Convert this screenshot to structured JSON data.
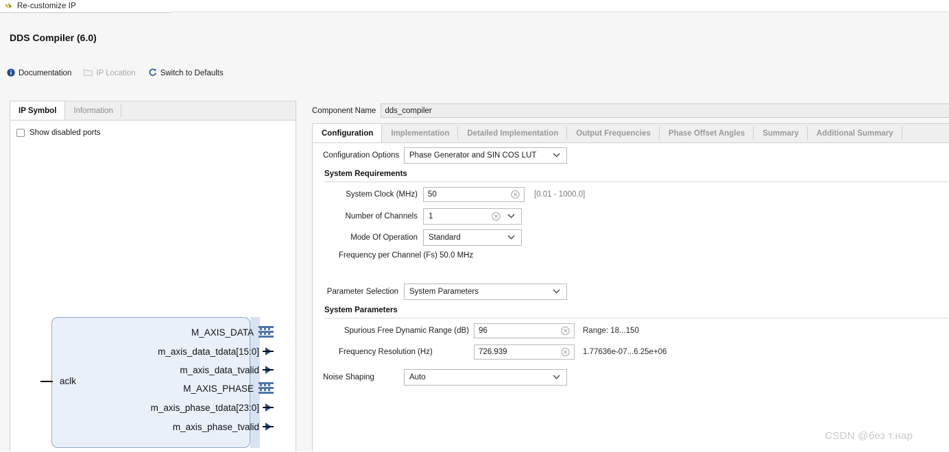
{
  "window": {
    "title": "Re-customize IP",
    "app_icon": "xilinx-logo-icon",
    "product_title": "DDS Compiler (6.0)"
  },
  "toolbar": {
    "items": [
      {
        "label": "Documentation",
        "icon": "info-icon",
        "disabled": false
      },
      {
        "label": "IP Location",
        "icon": "folder-icon",
        "disabled": true
      },
      {
        "label": "Switch to Defaults",
        "icon": "refresh-icon",
        "disabled": false
      }
    ]
  },
  "left_panel": {
    "tabs": [
      {
        "label": "IP Symbol",
        "active": true
      },
      {
        "label": "Information",
        "active": false
      }
    ],
    "show_disabled_ports": {
      "label": "Show disabled ports",
      "checked": false
    },
    "symbol": {
      "clock_port": "aclk",
      "ports": [
        {
          "name": "M_AXIS_DATA",
          "marker": "bus"
        },
        {
          "name": "m_axis_data_tdata[15:0]",
          "marker": "signal"
        },
        {
          "name": "m_axis_data_tvalid",
          "marker": "signal"
        },
        {
          "name": "M_AXIS_PHASE",
          "marker": "bus"
        },
        {
          "name": "m_axis_phase_tdata[23:0]",
          "marker": "signal"
        },
        {
          "name": "m_axis_phase_tvalid",
          "marker": "signal"
        }
      ]
    }
  },
  "right_panel": {
    "component_name": {
      "label": "Component Name",
      "value": "dds_compiler"
    },
    "tabs": [
      {
        "label": "Configuration",
        "active": true
      },
      {
        "label": "Implementation",
        "active": false
      },
      {
        "label": "Detailed Implementation",
        "active": false
      },
      {
        "label": "Output Frequencies",
        "active": false
      },
      {
        "label": "Phase Offset Angles",
        "active": false
      },
      {
        "label": "Summary",
        "active": false
      },
      {
        "label": "Additional Summary",
        "active": false
      }
    ],
    "configuration": {
      "configuration_options": {
        "label": "Configuration Options",
        "value": "Phase Generator and SIN COS LUT"
      },
      "system_requirements": {
        "heading": "System Requirements",
        "system_clock": {
          "label": "System Clock (MHz)",
          "value": "50",
          "range": "[0.01 - 1000.0]"
        },
        "number_of_channels": {
          "label": "Number of Channels",
          "value": "1"
        },
        "mode_of_operation": {
          "label": "Mode Of Operation",
          "value": "Standard"
        },
        "frequency_per_channel": "Frequency per Channel (Fs) 50.0 MHz"
      },
      "parameter_selection": {
        "label": "Parameter Selection",
        "value": "System Parameters"
      },
      "system_parameters": {
        "heading": "System Parameters",
        "sfdr": {
          "label": "Spurious Free Dynamic Range (dB)",
          "value": "96",
          "range": "Range: 18...150"
        },
        "frequency_resolution": {
          "label": "Frequency Resolution (Hz)",
          "value": "726.939",
          "range": "1.77636e-07...6.25e+06"
        },
        "noise_shaping": {
          "label": "Noise Shaping",
          "value": "Auto"
        }
      }
    }
  },
  "watermark": "CSDN @без т.нар",
  "colors": {
    "accent": "#1c4fa1",
    "symbol_fill": "#eaf0fa",
    "symbol_border": "#8da8cc",
    "header_bg": "#f6f6f6"
  }
}
